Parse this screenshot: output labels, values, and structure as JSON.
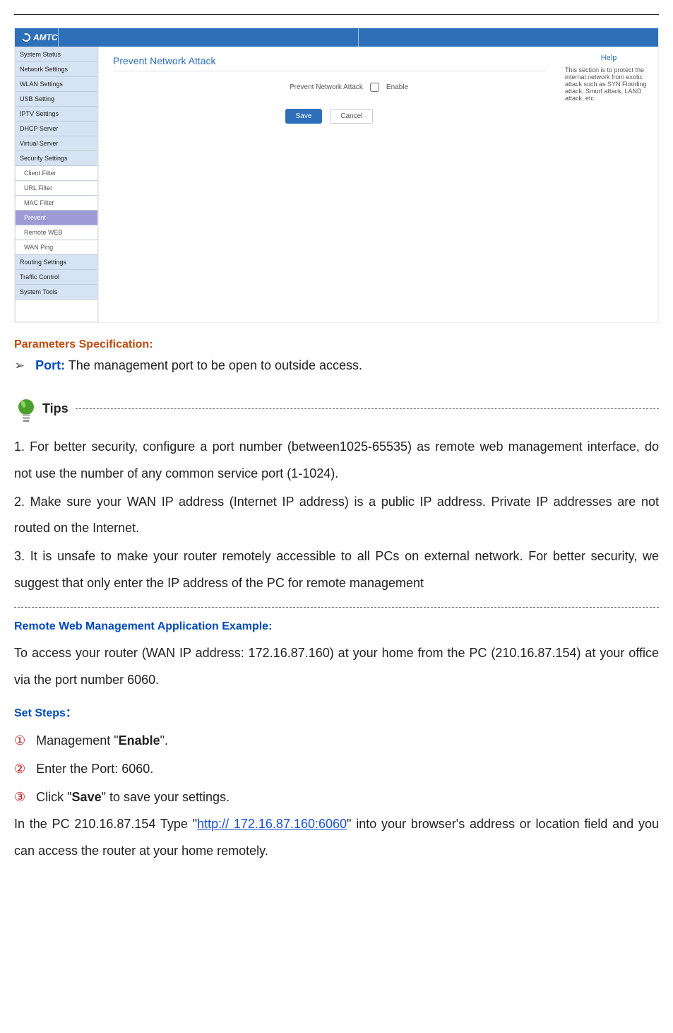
{
  "router": {
    "logo": "AMTC",
    "sidebar": {
      "items": [
        {
          "label": "System Status"
        },
        {
          "label": "Network Settings"
        },
        {
          "label": "WLAN Settings"
        },
        {
          "label": "USB Setting"
        },
        {
          "label": "IPTV Settings"
        },
        {
          "label": "DHCP Server"
        },
        {
          "label": "Virtual Server"
        },
        {
          "label": "Security Settings"
        },
        {
          "label": "Client Filter",
          "sub": true
        },
        {
          "label": "URL Filter",
          "sub": true
        },
        {
          "label": "MAC Filter",
          "sub": true
        },
        {
          "label": "Prevent",
          "sub": true,
          "active": true
        },
        {
          "label": "Remote WEB",
          "sub": true
        },
        {
          "label": "WAN Ping",
          "sub": true
        },
        {
          "label": "Routing Settings"
        },
        {
          "label": "Traffic Control"
        },
        {
          "label": "System Tools"
        }
      ]
    },
    "panel": {
      "title": "Prevent Network Attack",
      "row_label": "Prevent Network Attack",
      "enable_label": "Enable",
      "save": "Save",
      "cancel": "Cancel"
    },
    "help": {
      "title": "Help",
      "text": "This section is to protect the internal network from exotic attack such as SYN Flooding attack, Smurf attack, LAND attack, etc."
    }
  },
  "doc": {
    "params_heading": "Parameters Specification:",
    "port_label": "Port:",
    "port_desc": " The management port to be open to outside access.",
    "tips_label": "Tips",
    "tip1": "1. For better security, configure a port number (between1025-65535) as remote web management interface, do not use the number of any common service port (1-1024).",
    "tip2": "2. Make sure your WAN IP address (Internet IP address) is a public IP address. Private IP addresses are not routed on the Internet.",
    "tip3": "3. It is unsafe to make your router remotely accessible to all PCs on external network. For better security, we suggest that only enter the IP address of the PC for remote management",
    "example_heading": "Remote Web Management Application Example:",
    "example_text": "To access your router (WAN IP address: 172.16.87.160) at your home from the PC (210.16.87.154) at your office via the port number 6060.",
    "set_steps": "Set Steps：",
    "step1_pre": "Management \"",
    "step1_bold": "Enable",
    "step1_post": "\".",
    "step2": "Enter the Port: 6060.",
    "step3_pre": "Click \"",
    "step3_bold": "Save",
    "step3_post": "\" to save your settings.",
    "final_pre": "In the PC 210.16.87.154 Type \"",
    "final_link": "http:// 172.16.87.160:6060",
    "final_post": "\" into your browser's address or location field and you can access the router at your home remotely.",
    "circled": [
      "①",
      "②",
      "③"
    ]
  }
}
